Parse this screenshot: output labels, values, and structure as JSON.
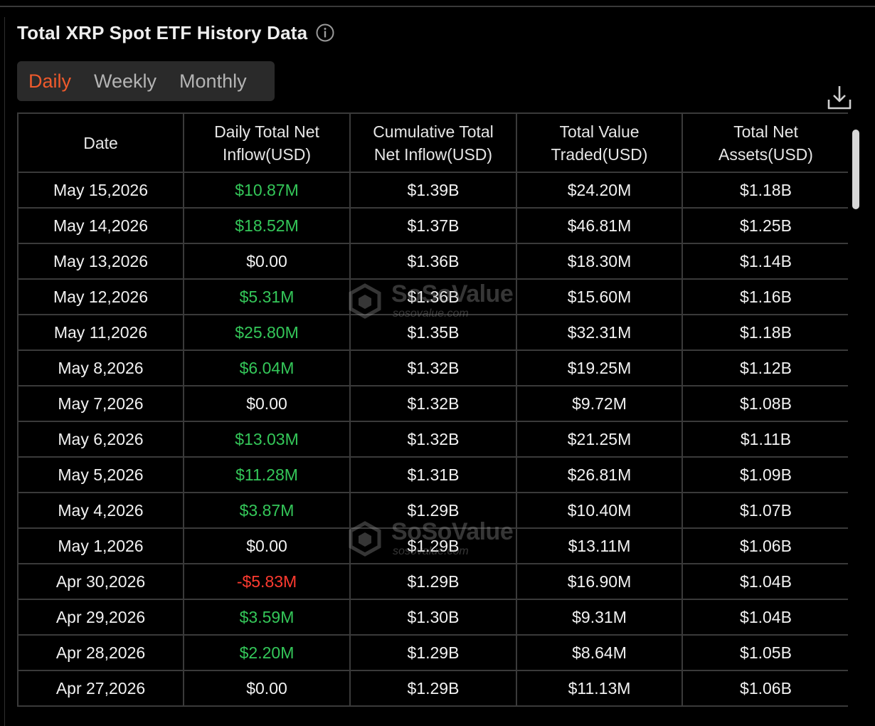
{
  "title": "Total XRP Spot ETF History Data",
  "icons": {
    "info": "info-icon",
    "download": "download-icon",
    "watermark_logo": "sosovalue-logo-icon"
  },
  "tabs": [
    {
      "label": "Daily",
      "active": true
    },
    {
      "label": "Weekly",
      "active": false
    },
    {
      "label": "Monthly",
      "active": false
    }
  ],
  "colors": {
    "accent": "#ef5a2c",
    "positive": "#34c759",
    "negative": "#ff3b30",
    "background": "#000000",
    "tab_bg": "#2a2a2a"
  },
  "table": {
    "headers": [
      {
        "line1": "Date",
        "line2": ""
      },
      {
        "line1": "Daily Total Net",
        "line2": "Inflow(USD)"
      },
      {
        "line1": "Cumulative Total",
        "line2": "Net Inflow(USD)"
      },
      {
        "line1": "Total Value",
        "line2": "Traded(USD)"
      },
      {
        "line1": "Total Net",
        "line2": "Assets(USD)"
      }
    ],
    "rows": [
      [
        "May 15,2026",
        "$10.87M",
        "$1.39B",
        "$24.20M",
        "$1.18B"
      ],
      [
        "May 14,2026",
        "$18.52M",
        "$1.37B",
        "$46.81M",
        "$1.25B"
      ],
      [
        "May 13,2026",
        "$0.00",
        "$1.36B",
        "$18.30M",
        "$1.14B"
      ],
      [
        "May 12,2026",
        "$5.31M",
        "$1.36B",
        "$15.60M",
        "$1.16B"
      ],
      [
        "May 11,2026",
        "$25.80M",
        "$1.35B",
        "$32.31M",
        "$1.18B"
      ],
      [
        "May 8,2026",
        "$6.04M",
        "$1.32B",
        "$19.25M",
        "$1.12B"
      ],
      [
        "May 7,2026",
        "$0.00",
        "$1.32B",
        "$9.72M",
        "$1.08B"
      ],
      [
        "May 6,2026",
        "$13.03M",
        "$1.32B",
        "$21.25M",
        "$1.11B"
      ],
      [
        "May 5,2026",
        "$11.28M",
        "$1.31B",
        "$26.81M",
        "$1.09B"
      ],
      [
        "May 4,2026",
        "$3.87M",
        "$1.29B",
        "$10.40M",
        "$1.07B"
      ],
      [
        "May 1,2026",
        "$0.00",
        "$1.29B",
        "$13.11M",
        "$1.06B"
      ],
      [
        "Apr 30,2026",
        "-$5.83M",
        "$1.29B",
        "$16.90M",
        "$1.04B"
      ],
      [
        "Apr 29,2026",
        "$3.59M",
        "$1.30B",
        "$9.31M",
        "$1.04B"
      ],
      [
        "Apr 28,2026",
        "$2.20M",
        "$1.29B",
        "$8.64M",
        "$1.05B"
      ],
      [
        "Apr 27,2026",
        "$0.00",
        "$1.29B",
        "$11.13M",
        "$1.06B"
      ]
    ]
  },
  "watermark": {
    "brand": "SoSoValue",
    "url": "sosovalue.com"
  }
}
